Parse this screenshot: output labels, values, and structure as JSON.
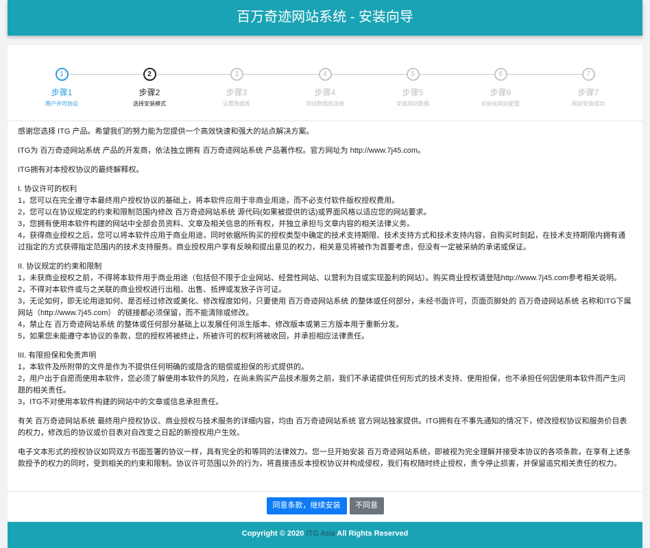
{
  "header": {
    "title": "百万奇迹网站系统 - 安装向导"
  },
  "steps": [
    {
      "num": "1",
      "title": "步骤1",
      "sub": "用户许可协议",
      "state": "done"
    },
    {
      "num": "2",
      "title": "步骤2",
      "sub": "选择安装模式",
      "state": "current"
    },
    {
      "num": "3",
      "title": "步骤3",
      "sub": "设置数据库",
      "state": "pending"
    },
    {
      "num": "4",
      "title": "步骤4",
      "sub": "测试数据库连接",
      "state": "pending"
    },
    {
      "num": "5",
      "title": "步骤5",
      "sub": "安装网站数据",
      "state": "pending"
    },
    {
      "num": "6",
      "title": "步骤6",
      "sub": "初始化网站配置",
      "state": "pending"
    },
    {
      "num": "7",
      "title": "步骤7",
      "sub": "网站安装成功",
      "state": "pending"
    }
  ],
  "agreement": {
    "p1": "感谢您选择 ITG 产品。希望我们的努力能为您提供一个高效快速和强大的站点解决方案。",
    "p2": "ITG为 百万奇迹网站系统 产品的开发商，依法独立拥有 百万奇迹网站系统 产品著作权。官方网址为 http://www.7j45.com。",
    "p3": "ITG拥有对本授权协议的最终解释权。",
    "s1": {
      "heading": "I. 协议许可的权利",
      "items": [
        "1，您可以在完全遵守本最终用户授权协议的基础上，将本软件应用于非商业用途，而不必支付软件版权授权费用。",
        "2，您可以在协议规定的约束和限制范围内修改 百万奇迹网站系统 源代码(如果被提供的话)或界面风格以适应您的网站要求。",
        "3，您拥有使用本软件构建的网站中全部会员资料、文章及相关信息的所有权，并独立承担与文章内容的相关法律义务。",
        "4，获得商业授权之后，您可以将本软件应用于商业用途，同时依据所购买的授权类型中确定的技术支持期限、技术支持方式和技术支持内容，自购买时刻起，在技术支持期限内拥有通过指定的方式获得指定范围内的技术支持服务。商业授权用户享有反映和提出意见的权力，相关意见将被作为首要考虑，但没有一定被采纳的承诺或保证。"
      ]
    },
    "s2": {
      "heading": "II. 协议规定的约束和限制",
      "items": [
        "1，未获商业授权之前，不得将本软件用于商业用途（包括但不限于企业网站、经营性网站、以营利为目或实现盈利的网站）。购买商业授权请登陆http://www.7j45.com参考相关说明。",
        "2，不得对本软件或与之关联的商业授权进行出租、出售、抵押或发放子许可证。",
        "3，无论如何，即无论用途如何、是否经过修改或美化、修改程度如何，只要使用 百万奇迹网站系统 的整体或任何部分，未经书面许可，页面页脚处的 百万奇迹网站系统 名称和ITG下属网站（http://www.7j45.com） 的链接都必须保留，而不能清除或修改。",
        "4，禁止在 百万奇迹网站系统 的整体或任何部分基础上以发展任何派生版本、修改版本或第三方版本用于重新分发。",
        "5，如果您未能遵守本协议的条款，您的授权将被终止，所被许可的权利将被收回，并承担相应法律责任。"
      ]
    },
    "s3": {
      "heading": "III. 有限担保和免责声明",
      "items": [
        "1，本软件及所附带的文件是作为不提供任何明确的或隐含的赔偿或担保的形式提供的。",
        "2，用户出于自愿而使用本软件，您必须了解使用本软件的风险，在尚未购买产品技术服务之前，我们不承诺提供任何形式的技术支持、使用担保，也不承担任何因使用本软件而产生问题的相关责任。",
        "3，ITG不对使用本软件构建的网站中的文章或信息承担责任。"
      ]
    },
    "p4": "有关 百万奇迹网站系统 最终用户授权协议、商业授权与技术服务的详细内容，均由 百万奇迹网站系统 官方网站独家提供。ITG拥有在不事先通知的情况下，修改授权协议和服务价目表的权力，修改后的协议或价目表对自改变之日起的新授权用户生效。",
    "p5": "电子文本形式的授权协议如同双方书面签署的协议一样，具有完全的和等同的法律效力。您一旦开始安装 百万奇迹网站系统，即被视为完全理解并接受本协议的各项条款，在享有上述条款授予的权力的同时，受到相关的约束和限制。协议许可范围以外的行为，将直接违反本授权协议并构成侵权，我们有权随时终止授权，责令停止损害，并保留追究相关责任的权力。"
  },
  "buttons": {
    "agree": "同意条款，继续安装",
    "disagree": "不同意"
  },
  "footer": {
    "prefix": "Copyright © 2020 ",
    "brand": "ITG Asia",
    "suffix": " All Rights Reserved"
  }
}
